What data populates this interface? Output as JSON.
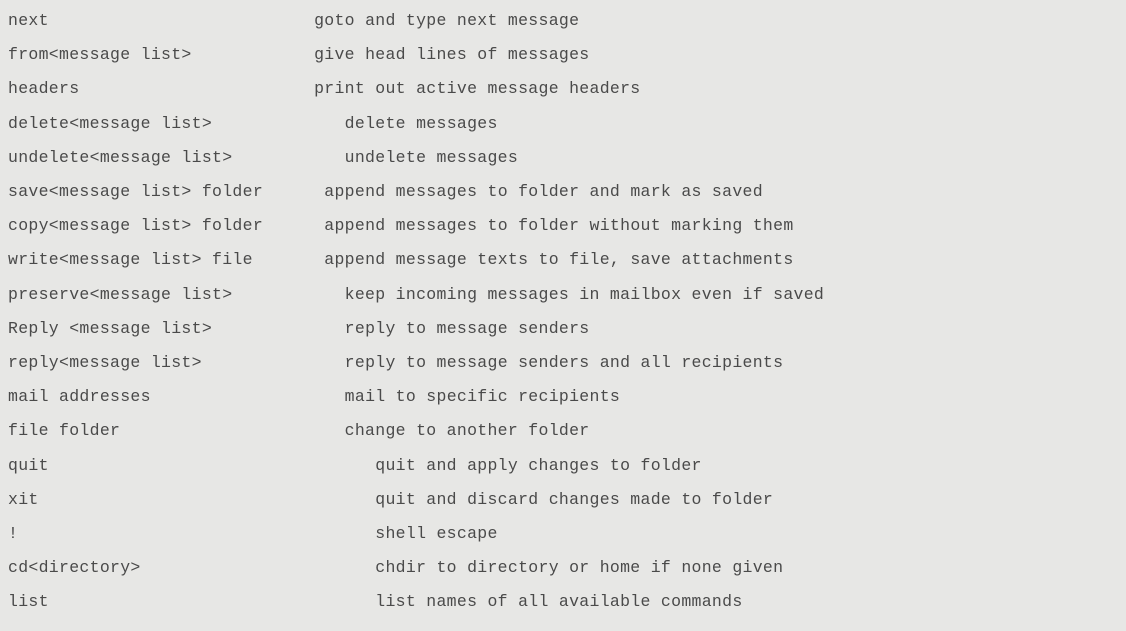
{
  "commands": [
    {
      "cmd": "next",
      "desc": "goto and type next message",
      "indent": 30,
      "doff": 0
    },
    {
      "cmd": "from<message list>",
      "desc": "give head lines of messages",
      "indent": 30,
      "doff": 0
    },
    {
      "cmd": "headers",
      "desc": "print out active message headers",
      "indent": 30,
      "doff": 0
    },
    {
      "cmd": "delete<message list>",
      "desc": "delete messages",
      "indent": 30,
      "doff": 3
    },
    {
      "cmd": "undelete<message list>",
      "desc": "undelete messages",
      "indent": 30,
      "doff": 3
    },
    {
      "cmd": "save<message list> folder",
      "desc": "append messages to folder and mark as saved",
      "indent": 28,
      "doff": 3
    },
    {
      "cmd": "copy<message list> folder",
      "desc": "append messages to folder without marking them",
      "indent": 28,
      "doff": 3
    },
    {
      "cmd": "write<message list> file",
      "desc": "append message texts to file, save attachments",
      "indent": 28,
      "doff": 3
    },
    {
      "cmd": "preserve<message list>",
      "desc": "keep incoming messages in mailbox even if saved",
      "indent": 30,
      "doff": 3
    },
    {
      "cmd": "Reply <message list>",
      "desc": "reply to message senders",
      "indent": 30,
      "doff": 3
    },
    {
      "cmd": "reply<message list>",
      "desc": "reply to message senders and all recipients",
      "indent": 30,
      "doff": 3
    },
    {
      "cmd": "mail addresses",
      "desc": "mail to specific recipients",
      "indent": 30,
      "doff": 3
    },
    {
      "cmd": "file folder",
      "desc": "change to another folder",
      "indent": 30,
      "doff": 3
    },
    {
      "cmd": "quit",
      "desc": "quit and apply changes to folder",
      "indent": 30,
      "doff": 6
    },
    {
      "cmd": "xit",
      "desc": "quit and discard changes made to folder",
      "indent": 30,
      "doff": 6
    },
    {
      "cmd": "!",
      "desc": "shell escape",
      "indent": 30,
      "doff": 6
    },
    {
      "cmd": "cd<directory>",
      "desc": "chdir to directory or home if none given",
      "indent": 30,
      "doff": 6
    },
    {
      "cmd": "list",
      "desc": "list names of all available commands",
      "indent": 30,
      "doff": 6
    }
  ]
}
